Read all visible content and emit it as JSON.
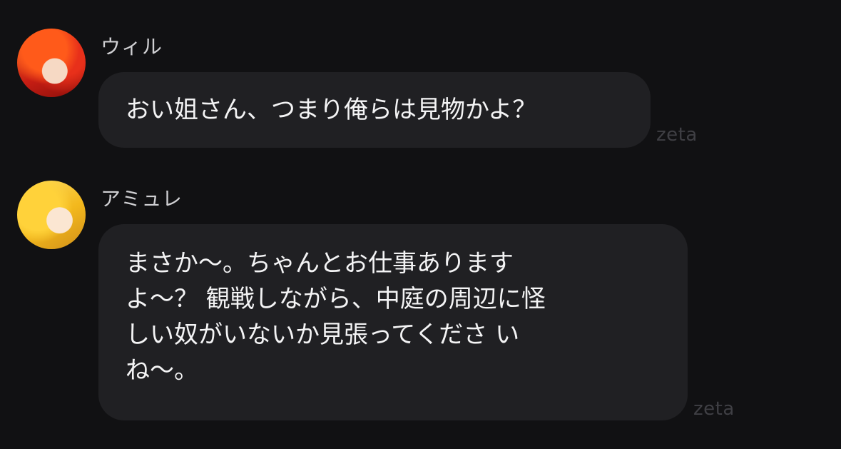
{
  "messages": [
    {
      "sender": "ウィル",
      "text": "おい姐さん、つまり俺らは見物かよ？",
      "watermark": "zeta"
    },
    {
      "sender": "アミュレ",
      "text": "まさか〜。ちゃんとお仕事あります\nよ〜？ 観戦しながら、中庭の周辺に怪\nしい奴がいないか見張ってくださ い\nね〜。",
      "watermark": "zeta"
    }
  ],
  "colors": {
    "background": "#111113",
    "bubble": "#202023",
    "text": "#f4f4f5",
    "sender": "#cfcfd2",
    "watermark": "#3f3f44"
  }
}
